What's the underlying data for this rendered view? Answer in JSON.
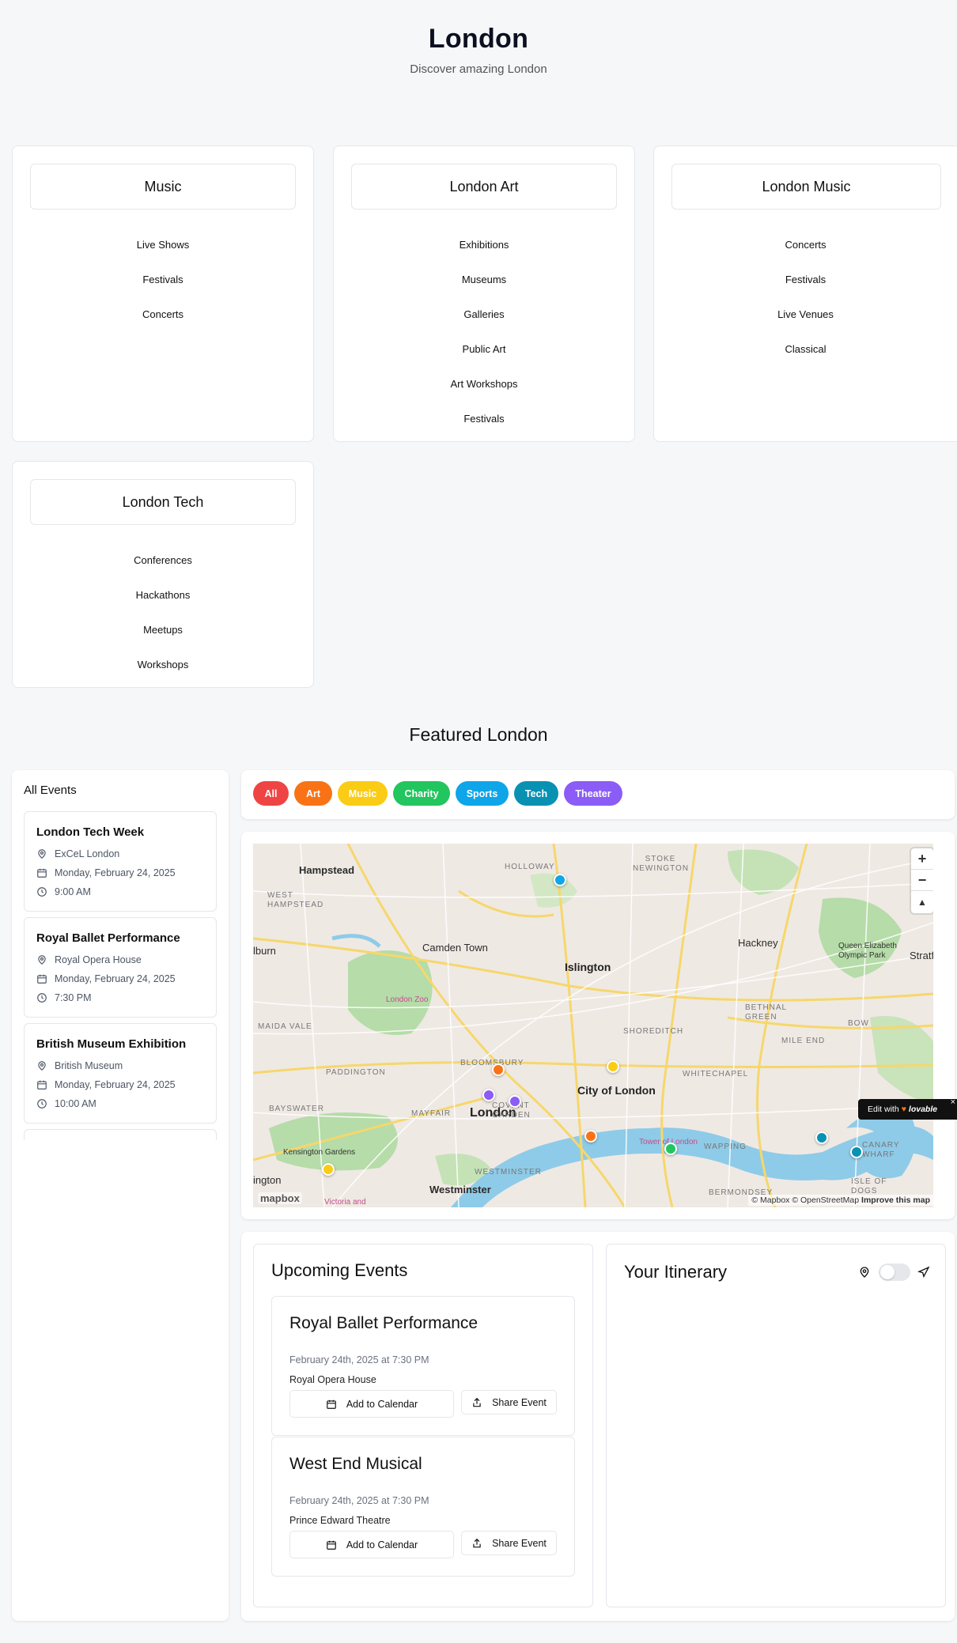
{
  "header": {
    "title": "London",
    "subtitle": "Discover amazing London"
  },
  "categories": [
    {
      "title": "Music",
      "items": [
        "Live Shows",
        "Festivals",
        "Concerts"
      ]
    },
    {
      "title": "London Art",
      "items": [
        "Exhibitions",
        "Museums",
        "Galleries",
        "Public Art",
        "Art Workshops",
        "Festivals"
      ]
    },
    {
      "title": "London Music",
      "items": [
        "Concerts",
        "Festivals",
        "Live Venues",
        "Classical"
      ]
    },
    {
      "title": "London Tech",
      "items": [
        "Conferences",
        "Hackathons",
        "Meetups",
        "Workshops"
      ]
    }
  ],
  "featured": {
    "title": "Featured London"
  },
  "events_panel": {
    "title": "All Events",
    "events": [
      {
        "title": "London Tech Week",
        "venue": "ExCeL London",
        "date": "Monday, February 24, 2025",
        "time": "9:00 AM"
      },
      {
        "title": "Royal Ballet Performance",
        "venue": "Royal Opera House",
        "date": "Monday, February 24, 2025",
        "time": "7:30 PM"
      },
      {
        "title": "British Museum Exhibition",
        "venue": "British Museum",
        "date": "Monday, February 24, 2025",
        "time": "10:00 AM"
      }
    ]
  },
  "filters": [
    {
      "label": "All",
      "color": "#ef4444"
    },
    {
      "label": "Art",
      "color": "#f97316"
    },
    {
      "label": "Music",
      "color": "#facc15"
    },
    {
      "label": "Charity",
      "color": "#22c55e"
    },
    {
      "label": "Sports",
      "color": "#0ea5e9"
    },
    {
      "label": "Tech",
      "color": "#0891b2"
    },
    {
      "label": "Theater",
      "color": "#8b5cf6"
    }
  ],
  "map": {
    "labels": {
      "hampstead": "Hampstead",
      "camden": "Camden Town",
      "islington": "Islington",
      "hackney": "Hackney",
      "city": "City of London",
      "london": "London",
      "westminster": "Westminster",
      "kensington": "Kensington Gardens",
      "queen_elizabeth": "Queen Elizabeth Olympic Park",
      "stratford": "Stratf",
      "kilburn": "lburn",
      "kensington_edge": "ington",
      "holloway": "HOLLOWAY",
      "stoke": "STOKE NEWINGTON",
      "west_hampstead": "WEST HAMPSTEAD",
      "maida": "MAIDA VALE",
      "paddington": "PADDINGTON",
      "bayswater": "BAYSWATER",
      "mayfair": "MAYFAIR",
      "bloomsbury": "BLOOMSBURY",
      "covent": "COVENT GARDEN",
      "shoreditch": "SHOREDITCH",
      "whitechapel": "WHITECHAPEL",
      "bethnal": "BETHNAL GREEN",
      "mile_end": "MILE END",
      "bow": "BOW",
      "wapping": "WAPPING",
      "bermondsey": "BERMONDSEY",
      "westminster_small": "WESTMINSTER",
      "london_zoo": "London Zoo",
      "tower": "Tower of London",
      "victoria": "Victoria and",
      "isle": "ISLE OF DOGS",
      "canary": "CANARY WHARF"
    },
    "attribution": "© Mapbox © OpenStreetMap",
    "improve": "Improve this map",
    "logo": "mapbox",
    "zoom_in": "+",
    "zoom_out": "−",
    "compass": "▲"
  },
  "edit_badge": {
    "prefix": "Edit with",
    "brand": "lovable",
    "close": "×"
  },
  "upcoming": {
    "title": "Upcoming Events",
    "add_label": "Add to Calendar",
    "share_label": "Share Event",
    "events": [
      {
        "title": "Royal Ballet Performance",
        "datetime": "February 24th, 2025 at 7:30 PM",
        "venue": "Royal Opera House"
      },
      {
        "title": "West End Musical",
        "datetime": "February 24th, 2025 at 7:30 PM",
        "venue": "Prince Edward Theatre"
      }
    ]
  },
  "itinerary": {
    "title": "Your Itinerary"
  },
  "colors": {
    "accent_red": "#ef4444",
    "text_dark": "#111827",
    "muted": "#6b7280"
  }
}
